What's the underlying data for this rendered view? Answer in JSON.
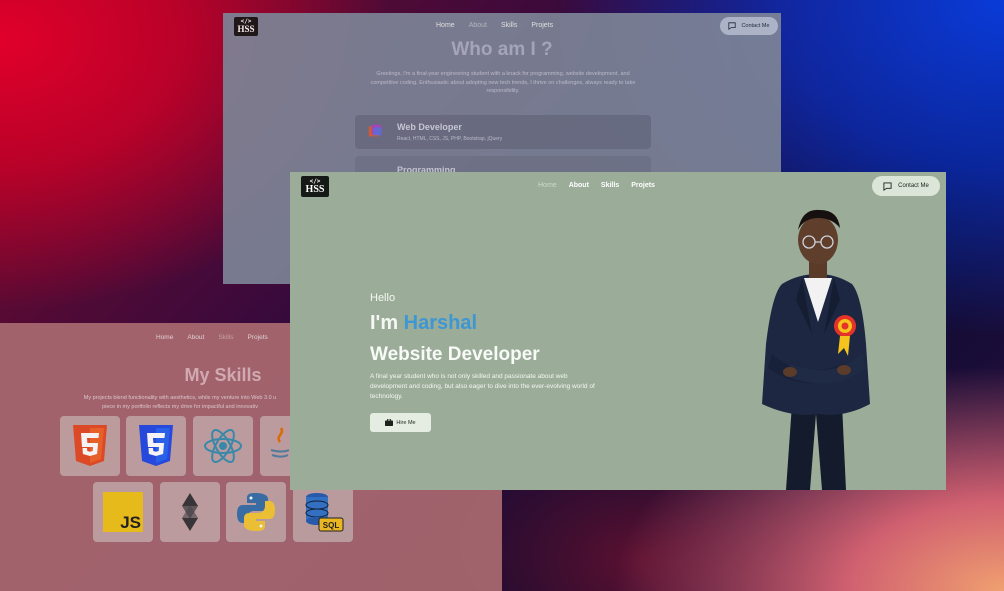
{
  "about_window": {
    "logo_code": "</>",
    "logo_text": "HSS",
    "nav": [
      "Home",
      "About",
      "Skills",
      "Projets"
    ],
    "contact_label": "Contact Me",
    "title": "Who am I ?",
    "description": "Greetings, I'm a final-year engineering student with a knack for programming, website development, and competitive coding. Enthusiastic about adopting new tech trends, I thrive on challenges, always ready to take responsibility.",
    "card1_title": "Web Developer",
    "card1_sub": "React, HTML, CSS, JS, PHP, Bootstrap, jQuery",
    "card2_title": "Programming"
  },
  "skills_window": {
    "nav": [
      "Home",
      "About",
      "Skills",
      "Projets"
    ],
    "title": "My Skills",
    "description_line1": "My projects blend functionality with aesthetics, while my venture into Web 3.0 u",
    "description_line2": "piece in my portfolio reflects my drive for impactful and innovativ",
    "tiles": [
      "html5-icon",
      "css3-icon",
      "react-icon",
      "java-icon",
      "javascript-icon",
      "solidity-icon",
      "python-icon",
      "sql-icon"
    ],
    "js_label": "JS",
    "sql_label": "SQL"
  },
  "home_window": {
    "logo_code": "</>",
    "logo_text": "HSS",
    "nav": [
      "Home",
      "About",
      "Skills",
      "Projets"
    ],
    "contact_label": "Contact Me",
    "hello": "Hello",
    "im": "I'm",
    "name": "Harshal",
    "role": "Website Developer",
    "bio": "A final year student who is not only skilled and passionate about web development and coding, but also eager to dive into the ever-evolving world of technology.",
    "hire_label": "Hire Me"
  },
  "colors": {
    "home_bg": "#9bad99",
    "name_accent": "#3d97d3",
    "about_bg": "#7d8497",
    "skills_bg": "#a7676f"
  }
}
